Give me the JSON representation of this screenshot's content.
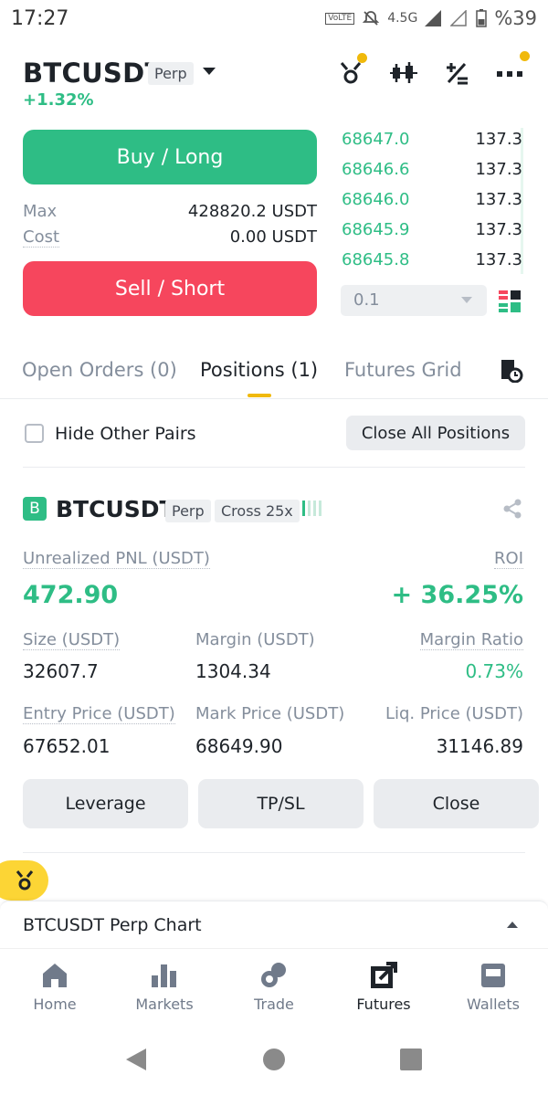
{
  "status_bar": {
    "time": "17:27",
    "network": "4.5G",
    "volte": "VoLTE",
    "battery": "%39"
  },
  "header": {
    "symbol": "BTCUSDT",
    "contract_tag": "Perp",
    "change": "+1.32%",
    "icons": [
      "gift-icon",
      "candlestick-icon",
      "calculator-icon",
      "more-icon"
    ]
  },
  "trade": {
    "buy_label": "Buy / Long",
    "sell_label": "Sell / Short",
    "max_label": "Max",
    "max_value": "428820.2 USDT",
    "cost_label": "Cost",
    "cost_value": "0.00 USDT"
  },
  "order_book": {
    "rows": [
      {
        "price": "68647.0",
        "qty": "137.3"
      },
      {
        "price": "68646.6",
        "qty": "137.3"
      },
      {
        "price": "68646.0",
        "qty": "137.3"
      },
      {
        "price": "68645.9",
        "qty": "137.3"
      },
      {
        "price": "68645.8",
        "qty": "137.3"
      }
    ],
    "precision": "0.1"
  },
  "tabs": [
    {
      "label": "Open Orders (0)",
      "active": false
    },
    {
      "label": "Positions (1)",
      "active": true
    },
    {
      "label": "Futures Grid",
      "active": false
    }
  ],
  "filter": {
    "hide_label": "Hide Other Pairs",
    "close_all": "Close All Positions"
  },
  "position": {
    "side_badge": "B",
    "symbol": "BTCUSDT",
    "contract_tag": "Perp",
    "margin_tag": "Cross 25x",
    "pnl_label": "Unrealized PNL (USDT)",
    "pnl_value": "472.90",
    "roi_label": "ROI",
    "roi_value": "+ 36.25%",
    "size_label": "Size (USDT)",
    "size_value": "32607.7",
    "margin_label": "Margin (USDT)",
    "margin_value": "1304.34",
    "margin_ratio_label": "Margin Ratio",
    "margin_ratio_value": "0.73%",
    "entry_label": "Entry Price (USDT)",
    "entry_value": "67652.01",
    "mark_label": "Mark Price (USDT)",
    "mark_value": "68649.90",
    "liq_label": "Liq. Price (USDT)",
    "liq_value": "31146.89",
    "buttons": {
      "leverage": "Leverage",
      "tpsl": "TP/SL",
      "close": "Close"
    }
  },
  "chart_bar": {
    "label": "BTCUSDT Perp Chart"
  },
  "nav": [
    {
      "label": "Home",
      "icon": "home-icon",
      "active": false
    },
    {
      "label": "Markets",
      "icon": "markets-icon",
      "active": false
    },
    {
      "label": "Trade",
      "icon": "trade-icon",
      "active": false
    },
    {
      "label": "Futures",
      "icon": "futures-icon",
      "active": true
    },
    {
      "label": "Wallets",
      "icon": "wallet-icon",
      "active": false
    }
  ],
  "colors": {
    "green": "#2ebd85",
    "red": "#f6465d",
    "yellow": "#f0b90b",
    "text": "#1e2329",
    "grey": "#848e9c"
  }
}
